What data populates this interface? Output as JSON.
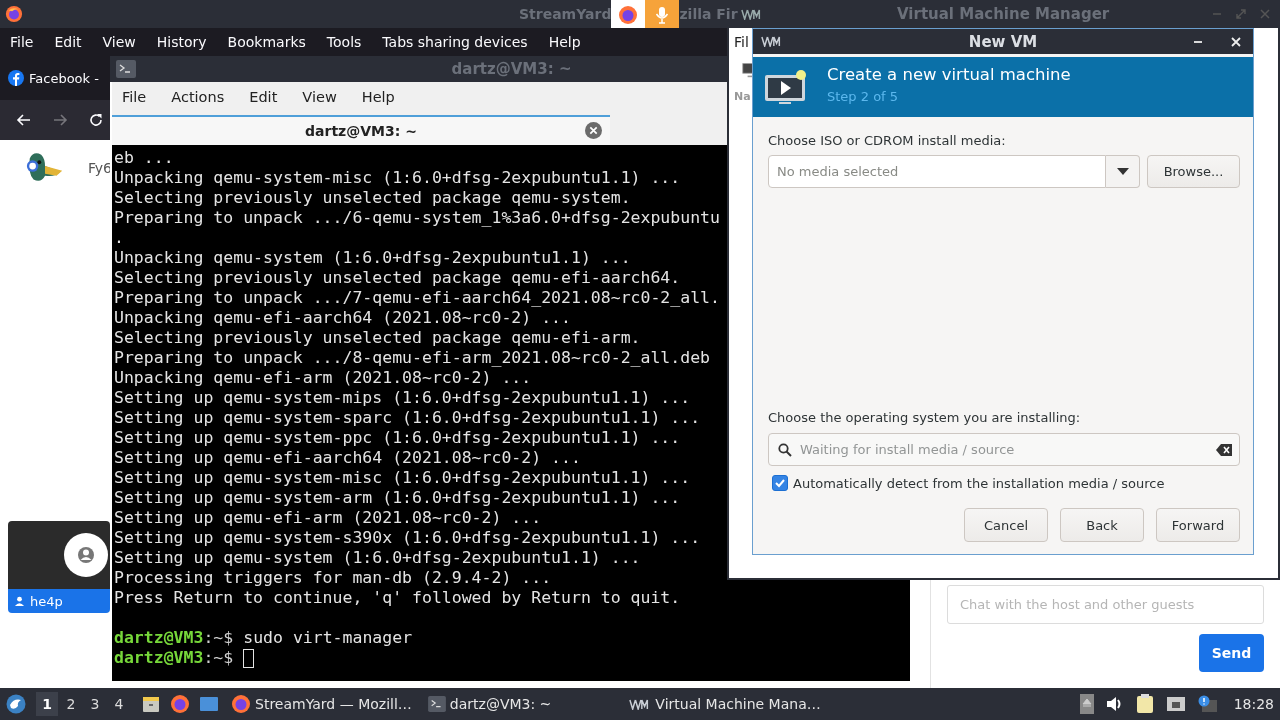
{
  "browser": {
    "title_parts": [
      "StreamYard",
      "zilla Fir"
    ],
    "menu": [
      "File",
      "Edit",
      "View",
      "History",
      "Bookmarks",
      "Tools",
      "Tabs sharing devices",
      "Help"
    ],
    "tab": {
      "title": "Facebook -"
    },
    "page": {
      "logo_text": "Fy6",
      "participant": {
        "name": "he4p"
      },
      "chat": {
        "placeholder": "Chat with the host and other guests"
      },
      "send_button": "Send"
    }
  },
  "vmm_window": {
    "title": "Virtual Machine Manager",
    "menu_fragment": "Fil",
    "column_fragment": "Na"
  },
  "terminal": {
    "title": "dartz@VM3: ~",
    "menu": [
      "File",
      "Actions",
      "Edit",
      "View",
      "Help"
    ],
    "tab": {
      "label": "dartz@VM3: ~"
    },
    "lines": [
      {
        "kind": "output",
        "text": "eb ..."
      },
      {
        "kind": "output",
        "text": "Unpacking qemu-system-misc (1:6.0+dfsg-2expubuntu1.1) ..."
      },
      {
        "kind": "output",
        "text": "Selecting previously unselected package qemu-system."
      },
      {
        "kind": "output",
        "text": "Preparing to unpack .../6-qemu-system_1%3a6.0+dfsg-2expubuntu"
      },
      {
        "kind": "output",
        "text": "."
      },
      {
        "kind": "output",
        "text": "Unpacking qemu-system (1:6.0+dfsg-2expubuntu1.1) ..."
      },
      {
        "kind": "output",
        "text": "Selecting previously unselected package qemu-efi-aarch64."
      },
      {
        "kind": "output",
        "text": "Preparing to unpack .../7-qemu-efi-aarch64_2021.08~rc0-2_all."
      },
      {
        "kind": "output",
        "text": "Unpacking qemu-efi-aarch64 (2021.08~rc0-2) ..."
      },
      {
        "kind": "output",
        "text": "Selecting previously unselected package qemu-efi-arm."
      },
      {
        "kind": "output",
        "text": "Preparing to unpack .../8-qemu-efi-arm_2021.08~rc0-2_all.deb"
      },
      {
        "kind": "output",
        "text": "Unpacking qemu-efi-arm (2021.08~rc0-2) ..."
      },
      {
        "kind": "output",
        "text": "Setting up qemu-system-mips (1:6.0+dfsg-2expubuntu1.1) ..."
      },
      {
        "kind": "output",
        "text": "Setting up qemu-system-sparc (1:6.0+dfsg-2expubuntu1.1) ..."
      },
      {
        "kind": "output",
        "text": "Setting up qemu-system-ppc (1:6.0+dfsg-2expubuntu1.1) ..."
      },
      {
        "kind": "output",
        "text": "Setting up qemu-efi-aarch64 (2021.08~rc0-2) ..."
      },
      {
        "kind": "output",
        "text": "Setting up qemu-system-misc (1:6.0+dfsg-2expubuntu1.1) ..."
      },
      {
        "kind": "output",
        "text": "Setting up qemu-system-arm (1:6.0+dfsg-2expubuntu1.1) ..."
      },
      {
        "kind": "output",
        "text": "Setting up qemu-efi-arm (2021.08~rc0-2) ..."
      },
      {
        "kind": "output",
        "text": "Setting up qemu-system-s390x (1:6.0+dfsg-2expubuntu1.1) ..."
      },
      {
        "kind": "output",
        "text": "Setting up qemu-system (1:6.0+dfsg-2expubuntu1.1) ..."
      },
      {
        "kind": "output",
        "text": "Processing triggers for man-db (2.9.4-2) ..."
      },
      {
        "kind": "output",
        "text": "Press Return to continue, 'q' followed by Return to quit."
      },
      {
        "kind": "blank"
      },
      {
        "kind": "prompt",
        "user": "dartz@VM3",
        "suffix": ":~$",
        "command": "sudo virt-manager",
        "cursor": false
      },
      {
        "kind": "prompt",
        "user": "dartz@VM3",
        "suffix": ":~$",
        "cursor": true
      }
    ]
  },
  "new_vm_dialog": {
    "title": "New VM",
    "header_title": "Create a new virtual machine",
    "header_step": "Step 2 of 5",
    "media_label": "Choose ISO or CDROM install media:",
    "media_placeholder": "No media selected",
    "browse_button": "Browse...",
    "os_label": "Choose the operating system you are installing:",
    "os_placeholder": "Waiting for install media / source",
    "autodetect": {
      "label": "Automatically detect from the installation media / source",
      "checked": true
    },
    "buttons": [
      "Cancel",
      "Back",
      "Forward"
    ]
  },
  "taskbar": {
    "workspaces": [
      {
        "label": "1",
        "selected": true
      },
      {
        "label": "2",
        "selected": false
      },
      {
        "label": "3",
        "selected": false
      },
      {
        "label": "4",
        "selected": false
      }
    ],
    "tasks": [
      {
        "kind": "firefox",
        "label": "StreamYard — Mozill…"
      },
      {
        "kind": "terminal",
        "label": "dartz@VM3: ~"
      },
      {
        "kind": "vmm",
        "label": "Virtual Machine Mana…"
      }
    ],
    "clock": "18:28"
  }
}
